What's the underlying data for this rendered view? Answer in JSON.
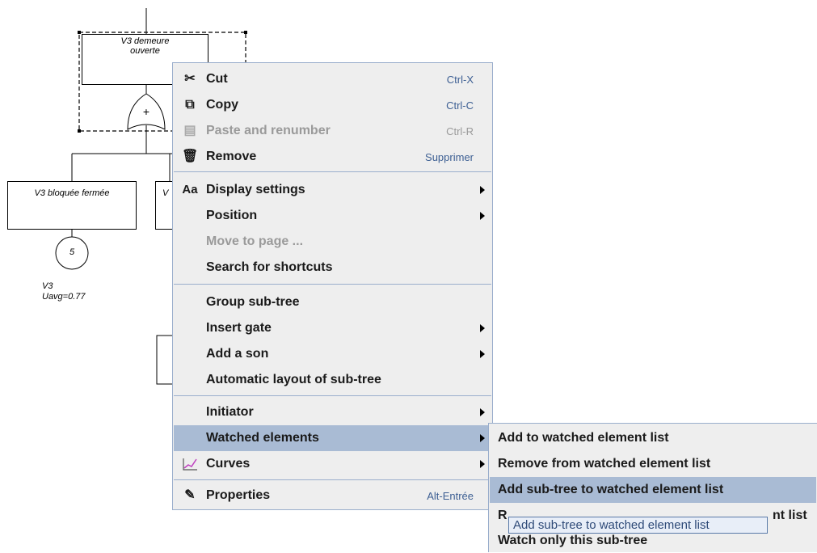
{
  "diagram": {
    "top_node_label": "V3 demeure ouverte",
    "gate_symbol": "+",
    "left_node_label": "V3 bloquée fermée",
    "second_node_label": "V",
    "event_number": "5",
    "note_line1": "V3",
    "note_line2": "Uavg=0.77"
  },
  "context_menu": {
    "items": [
      {
        "icon": "cut-icon",
        "label": "Cut",
        "shortcut": "Ctrl-X"
      },
      {
        "icon": "copy-icon",
        "label": "Copy",
        "shortcut": "Ctrl-C"
      },
      {
        "icon": "paste-icon",
        "label": "Paste and renumber",
        "shortcut": "Ctrl-R"
      },
      {
        "icon": "trash-icon",
        "label": "Remove",
        "shortcut": "Supprimer"
      },
      {
        "icon": "font-icon",
        "icon_text": "Aa",
        "label": "Display settings"
      },
      {
        "label": "Position"
      },
      {
        "label": "Move to page ..."
      },
      {
        "label": "Search for shortcuts"
      },
      {
        "label": "Group sub-tree"
      },
      {
        "label": "Insert gate"
      },
      {
        "label": "Add a son"
      },
      {
        "label": "Automatic layout of sub-tree"
      },
      {
        "label": "Initiator"
      },
      {
        "label": "Watched elements"
      },
      {
        "icon": "chart-icon",
        "label": "Curves"
      },
      {
        "icon": "properties-icon",
        "label": "Properties",
        "shortcut": "Alt-Entrée"
      }
    ]
  },
  "submenu": {
    "items": [
      {
        "label": "Add to watched element list"
      },
      {
        "label": "Remove from watched element list"
      },
      {
        "label": "Add sub-tree to watched element list"
      },
      {
        "label_start": "R",
        "label_end": "nt list"
      },
      {
        "label": "Watch only this sub-tree"
      }
    ]
  },
  "tooltip": {
    "text": "Add sub-tree to watched element list"
  },
  "colors": {
    "menu_background": "#eeeeee",
    "menu_border": "#9aaecc",
    "highlight": "#a9bbd4",
    "shortcut_text": "#3d5f93"
  }
}
